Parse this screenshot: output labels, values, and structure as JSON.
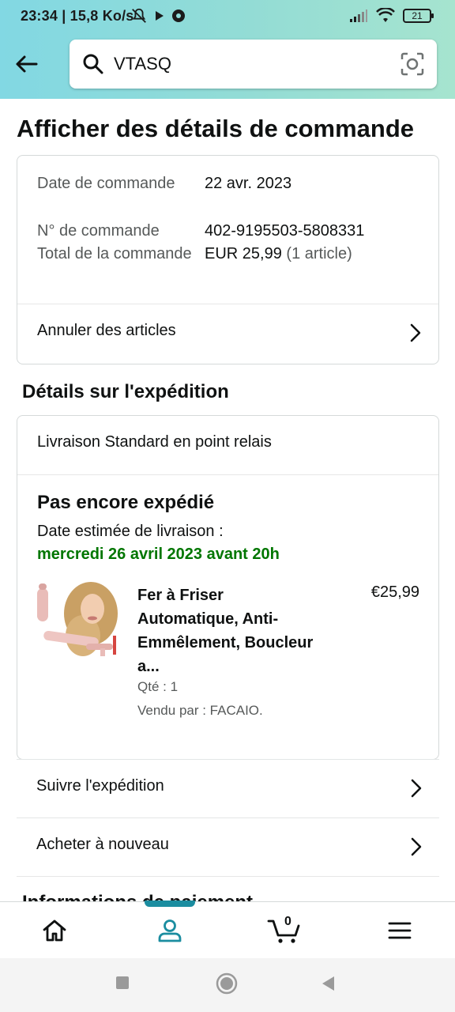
{
  "status_bar": {
    "time_speed": "23:34 | 15,8 Ko/s",
    "battery": "21"
  },
  "search": {
    "query": "VTASQ"
  },
  "page": {
    "title": "Afficher des détails de commande"
  },
  "order": {
    "date_label": "Date de commande",
    "date_value": "22 avr. 2023",
    "number_label": "N° de commande",
    "number_value": "402-9195503-5808331",
    "total_label": "Total de la commande",
    "total_value": "EUR 25,99",
    "total_count": "(1 article)",
    "cancel_label": "Annuler des articles"
  },
  "shipping": {
    "section_title": "Détails sur l'expédition",
    "type": "Livraison Standard en point relais",
    "status": "Pas encore expédié",
    "eta_label": "Date estimée de livraison :",
    "eta_date": "mercredi 26 avril 2023 avant 20h"
  },
  "product": {
    "name": "Fer à Friser Automatique, Anti-Emmêlement, Boucleur a...",
    "price": "€25,99",
    "qty": "Qté : 1",
    "seller": "Vendu par : FACAIO."
  },
  "actions": {
    "track": "Suivre l'expédition",
    "buy_again": "Acheter à nouveau"
  },
  "next_section_peek": "Informations de paiement",
  "bottom_nav": {
    "cart_count": "0",
    "active_tab": "account"
  },
  "colors": {
    "header_gradient_start": "#82d8e3",
    "header_gradient_end": "#a6e4cf",
    "delivery_green": "#007600",
    "active_tab": "#1b8da0"
  }
}
